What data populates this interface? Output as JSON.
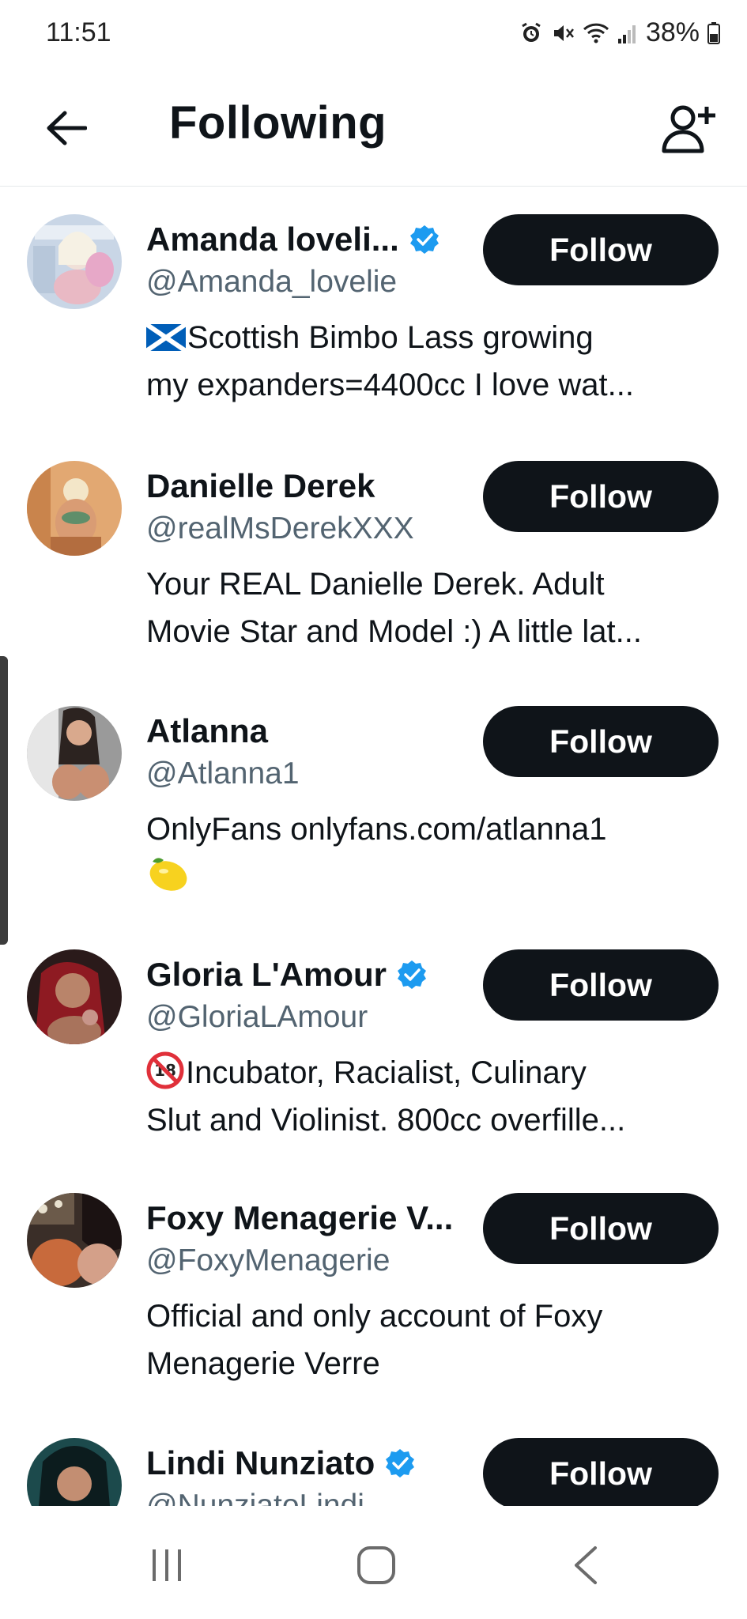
{
  "status_bar": {
    "time": "11:51",
    "battery": "38%",
    "icons": [
      "alarm-icon",
      "mute-icon",
      "wifi-icon",
      "signal-icon",
      "battery-icon"
    ]
  },
  "header": {
    "title": "Following",
    "back_icon": "arrow-left-icon",
    "action_icon": "add-user-icon"
  },
  "accounts": [
    {
      "name": "Amanda loveli...",
      "handle": "@Amanda_lovelie",
      "verified": true,
      "bio_line1": "Scottish Bimbo Lass growing",
      "bio_line2": "my expanders=4400cc I love wat...",
      "bio_emoji": "scotland-flag-icon",
      "follow_label": "Follow"
    },
    {
      "name": "Danielle Derek",
      "handle": "@realMsDerekXXX",
      "verified": false,
      "bio_line1": "Your REAL Danielle Derek. Adult",
      "bio_line2": "Movie Star and Model :) A little lat...",
      "follow_label": "Follow"
    },
    {
      "name": "Atlanna",
      "handle": "@Atlanna1",
      "verified": false,
      "bio_line1": "OnlyFans onlyfans.com/atlanna1",
      "bio_line2_emoji": "lemon-icon",
      "follow_label": "Follow"
    },
    {
      "name": "Gloria L'Amour",
      "handle": "@GloriaLAmour",
      "verified": true,
      "bio_line1": "Incubator, Racialist, Culinary",
      "bio_line2": "Slut and Violinist. 800cc overfille...",
      "bio_emoji": "no-under-18-icon",
      "follow_label": "Follow"
    },
    {
      "name": "Foxy Menagerie V...",
      "handle": "@FoxyMenagerie",
      "verified": false,
      "bio_line1": "Official and only account of Foxy",
      "bio_line2": "Menagerie Verre",
      "follow_label": "Follow"
    },
    {
      "name": "Lindi Nunziato",
      "handle": "@NunziatoLindi",
      "verified": true,
      "follow_label": "Follow"
    }
  ],
  "colors": {
    "follow_button": "#0f1419",
    "verified": "#1d9bf0",
    "handle": "#536471"
  },
  "nav_bar": {
    "icons": [
      "recent-apps-icon",
      "home-icon",
      "back-icon"
    ]
  }
}
